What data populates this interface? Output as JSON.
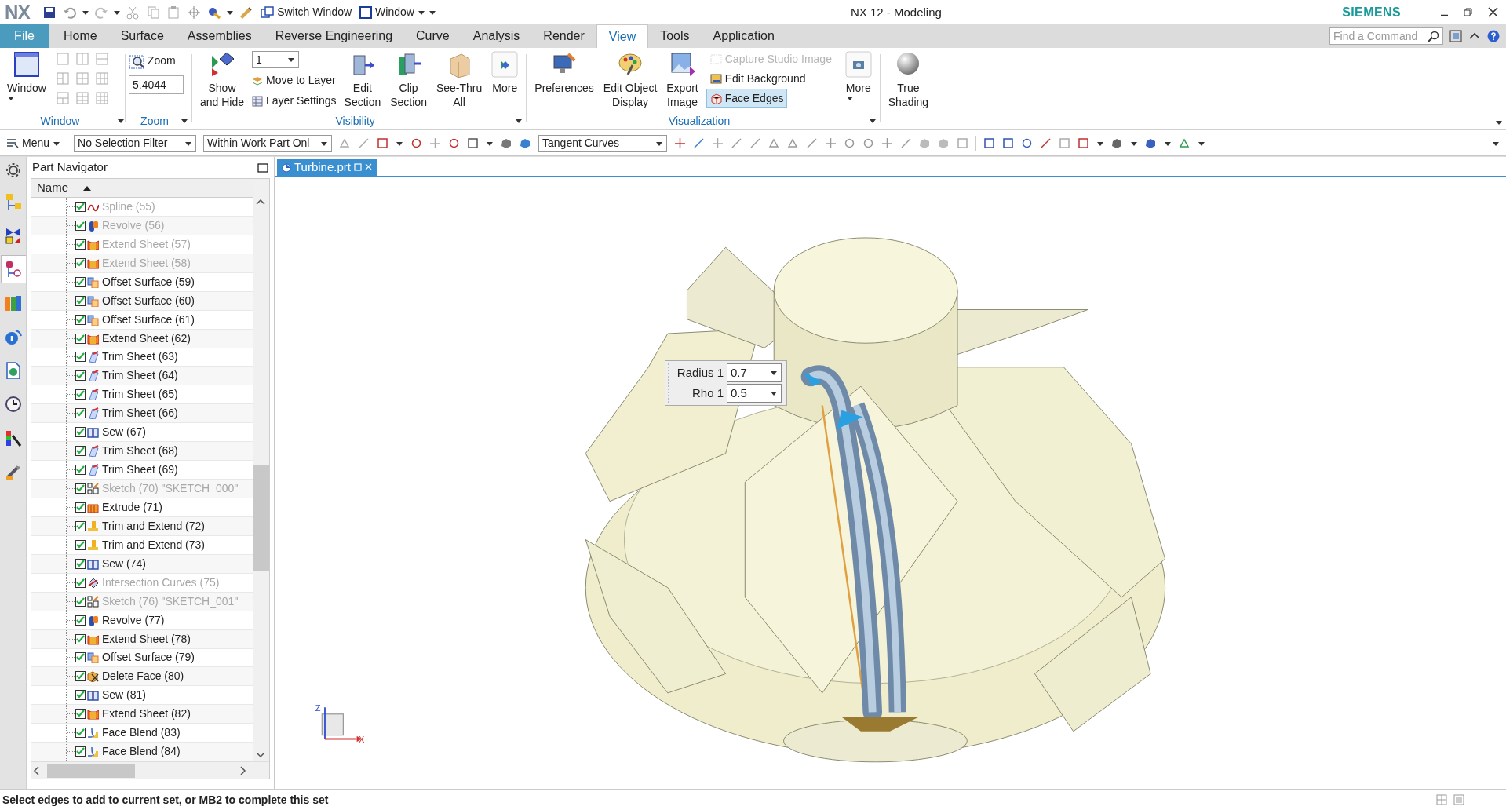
{
  "title_bar": {
    "logo": "NX",
    "switch_window": "Switch Window",
    "window_menu": "Window",
    "title": "NX 12 - Modeling",
    "brand": "SIEMENS"
  },
  "ribbon_tabs": [
    {
      "label": "File",
      "kind": "file",
      "selected": false
    },
    {
      "label": "Home",
      "kind": "tab",
      "selected": false
    },
    {
      "label": "Surface",
      "kind": "tab",
      "selected": false
    },
    {
      "label": "Assemblies",
      "kind": "tab",
      "selected": false
    },
    {
      "label": "Reverse Engineering",
      "kind": "tab",
      "selected": false
    },
    {
      "label": "Curve",
      "kind": "tab",
      "selected": false
    },
    {
      "label": "Analysis",
      "kind": "tab",
      "selected": false
    },
    {
      "label": "Render",
      "kind": "tab",
      "selected": false
    },
    {
      "label": "View",
      "kind": "tab",
      "selected": true
    },
    {
      "label": "Tools",
      "kind": "tab",
      "selected": false
    },
    {
      "label": "Application",
      "kind": "tab",
      "selected": false
    }
  ],
  "command_search": {
    "placeholder": "Find a Command"
  },
  "ribbon": {
    "window_group": {
      "label": "Window",
      "button": "Window"
    },
    "zoom_group": {
      "label": "Zoom",
      "button": "Zoom",
      "scale": "5.4044"
    },
    "visibility_group": {
      "label": "Visibility",
      "show_hide": [
        "Show",
        "and Hide"
      ],
      "layer": "1",
      "move_to_layer": "Move to Layer",
      "layer_settings": "Layer Settings",
      "buttons": [
        {
          "lines": [
            "Edit",
            "Section"
          ],
          "kind": "edit_section"
        },
        {
          "lines": [
            "Clip",
            "Section"
          ],
          "kind": "clip_section"
        },
        {
          "lines": [
            "See-Thru",
            "All"
          ],
          "kind": "see_thru"
        },
        {
          "lines": [
            "More"
          ],
          "kind": "more"
        }
      ]
    },
    "visualization_group": {
      "label": "Visualization",
      "buttons": [
        {
          "lines": [
            "Preferences"
          ],
          "kind": "preferences"
        },
        {
          "lines": [
            "Edit Object",
            "Display"
          ],
          "kind": "edit_display"
        },
        {
          "lines": [
            "Export",
            "Image"
          ],
          "kind": "export_image"
        }
      ],
      "small_buttons": [
        {
          "label": "Capture Studio Image",
          "disabled": true,
          "on": false
        },
        {
          "label": "Edit Background",
          "disabled": false,
          "on": false
        },
        {
          "label": "Face Edges",
          "disabled": false,
          "on": true
        }
      ],
      "more": "More"
    },
    "shading_group": {
      "lines": [
        "True",
        "Shading"
      ]
    }
  },
  "toolbar": {
    "menu": "Menu",
    "selection_filter": "No Selection Filter",
    "scope": "Within Work Part Onl",
    "curve_rule": "Tangent Curves"
  },
  "navigator": {
    "title": "Part Navigator",
    "column": "Name",
    "rows": [
      {
        "label": "Spline (55)",
        "kind": "spline",
        "checked": true,
        "dimmed": true
      },
      {
        "label": "Revolve (56)",
        "kind": "revolve",
        "checked": true,
        "dimmed": true
      },
      {
        "label": "Extend Sheet (57)",
        "kind": "extend",
        "checked": true,
        "dimmed": true
      },
      {
        "label": "Extend Sheet (58)",
        "kind": "extend",
        "checked": true,
        "dimmed": true
      },
      {
        "label": "Offset Surface (59)",
        "kind": "offset",
        "checked": true,
        "dimmed": false
      },
      {
        "label": "Offset Surface (60)",
        "kind": "offset",
        "checked": true,
        "dimmed": false
      },
      {
        "label": "Offset Surface (61)",
        "kind": "offset",
        "checked": true,
        "dimmed": false
      },
      {
        "label": "Extend Sheet (62)",
        "kind": "extend",
        "checked": true,
        "dimmed": false
      },
      {
        "label": "Trim Sheet (63)",
        "kind": "trim",
        "checked": true,
        "dimmed": false
      },
      {
        "label": "Trim Sheet (64)",
        "kind": "trim",
        "checked": true,
        "dimmed": false
      },
      {
        "label": "Trim Sheet (65)",
        "kind": "trim",
        "checked": true,
        "dimmed": false
      },
      {
        "label": "Trim Sheet (66)",
        "kind": "trim",
        "checked": true,
        "dimmed": false
      },
      {
        "label": "Sew (67)",
        "kind": "sew",
        "checked": true,
        "dimmed": false
      },
      {
        "label": "Trim Sheet (68)",
        "kind": "trim",
        "checked": true,
        "dimmed": false
      },
      {
        "label": "Trim Sheet (69)",
        "kind": "trim",
        "checked": true,
        "dimmed": false
      },
      {
        "label": "Sketch (70) \"SKETCH_000\"",
        "kind": "sketch",
        "checked": true,
        "dimmed": true
      },
      {
        "label": "Extrude (71)",
        "kind": "extrude",
        "checked": true,
        "dimmed": false
      },
      {
        "label": "Trim and Extend (72)",
        "kind": "trim_extend",
        "checked": true,
        "dimmed": false
      },
      {
        "label": "Trim and Extend (73)",
        "kind": "trim_extend",
        "checked": true,
        "dimmed": false
      },
      {
        "label": "Sew (74)",
        "kind": "sew",
        "checked": true,
        "dimmed": false
      },
      {
        "label": "Intersection Curves (75)",
        "kind": "intersection",
        "checked": true,
        "dimmed": true
      },
      {
        "label": "Sketch (76) \"SKETCH_001\"",
        "kind": "sketch",
        "checked": true,
        "dimmed": true
      },
      {
        "label": "Revolve (77)",
        "kind": "revolve",
        "checked": true,
        "dimmed": false
      },
      {
        "label": "Extend Sheet (78)",
        "kind": "extend",
        "checked": true,
        "dimmed": false
      },
      {
        "label": "Offset Surface (79)",
        "kind": "offset",
        "checked": true,
        "dimmed": false
      },
      {
        "label": "Delete Face (80)",
        "kind": "delete_face",
        "checked": true,
        "dimmed": false
      },
      {
        "label": "Sew (81)",
        "kind": "sew",
        "checked": true,
        "dimmed": false
      },
      {
        "label": "Extend Sheet (82)",
        "kind": "extend",
        "checked": true,
        "dimmed": false
      },
      {
        "label": "Face Blend (83)",
        "kind": "face_blend",
        "checked": true,
        "dimmed": false
      },
      {
        "label": "Face Blend (84)",
        "kind": "face_blend",
        "checked": true,
        "dimmed": false
      }
    ]
  },
  "document_tab": {
    "label": "Turbine.prt",
    "selected": true
  },
  "blend_dialog": {
    "fields": [
      {
        "label": "Radius 1",
        "value": "0.7"
      },
      {
        "label": "Rho 1",
        "value": "0.5"
      }
    ]
  },
  "triad": {
    "z_label": "Z",
    "x_label": "X"
  },
  "status_bar": {
    "message": "Select edges to add to current set, or MB2 to complete this set"
  }
}
